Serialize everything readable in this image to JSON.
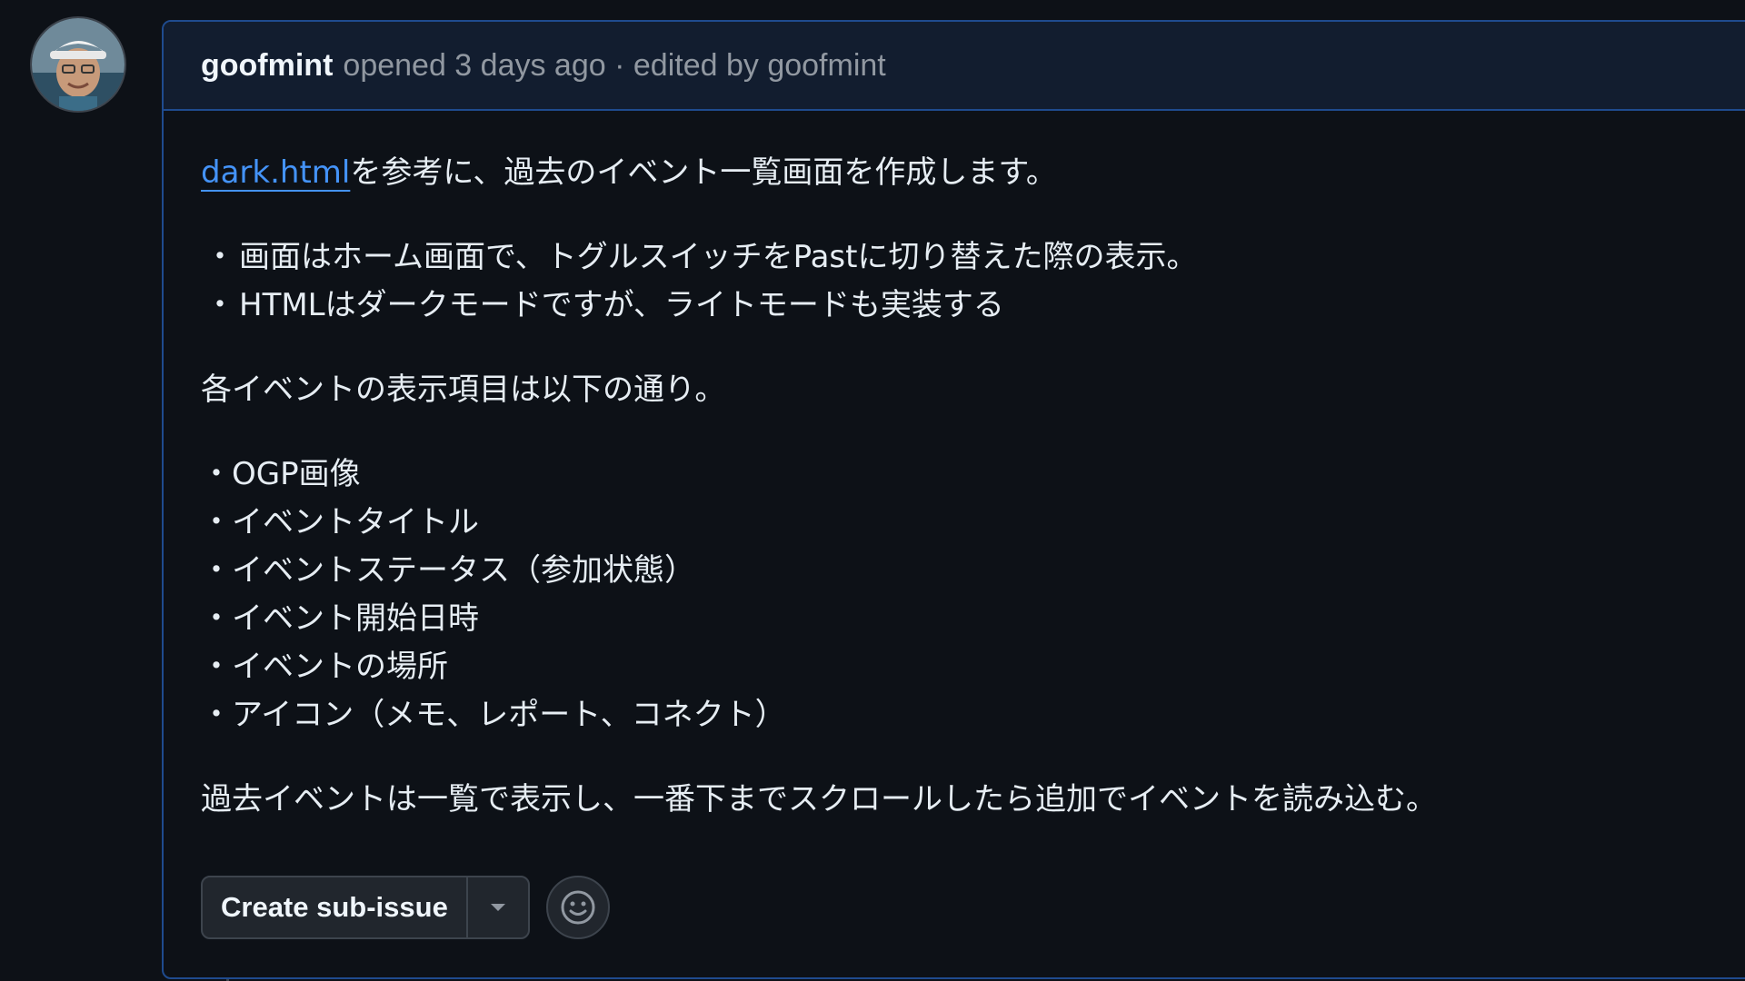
{
  "comment": {
    "author": "goofmint",
    "meta": "opened 3 days ago · edited by",
    "editor": "goofmint",
    "avatar_icon": "user-avatar-icon"
  },
  "body": {
    "intro_link": "dark.html",
    "intro_text": "を参考に、過去のイベント一覧画面を作成します。",
    "bullet_char": "・",
    "bullets": [
      "画面はホーム画面で、トグルスイッチをPastに切り替えた際の表示。",
      "HTMLはダークモードですが、ライトモードも実装する"
    ],
    "items_intro": "各イベントの表示項目は以下の通り。",
    "items": [
      "・OGP画像",
      "・イベントタイトル",
      "・イベントステータス（参加状態）",
      "・イベント開始日時",
      "・イベントの場所",
      "・アイコン（メモ、レポート、コネクト）"
    ],
    "closing": "過去イベントは一覧で表示し、一番下までスクロールしたら追加でイベントを読み込む。"
  },
  "actions": {
    "create_sub_issue_label": "Create sub-issue",
    "dropdown_icon": "triangle-down-icon",
    "reaction_icon": "smiley-icon"
  },
  "colors": {
    "background": "#0d1117",
    "header_bg": "#121d2f",
    "border_accent": "#1f4b8e",
    "link": "#4493f8",
    "muted_text": "#9198a1"
  }
}
